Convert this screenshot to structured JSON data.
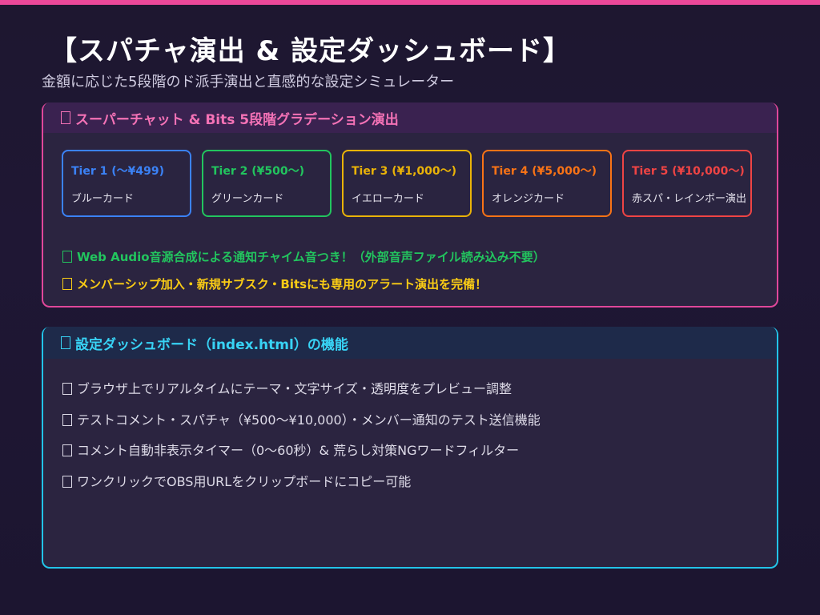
{
  "header": {
    "title": "【スパチャ演出 & 設定ダッシュボード】",
    "subtitle": "金額に応じた5段階のド派手演出と直感的な設定シミュレーター"
  },
  "superchat_section": {
    "heading": "スーパーチャット & Bits 5段階グラデーション演出",
    "tiers": [
      {
        "name": "Tier 1 (〜¥499)",
        "desc": "ブルーカード",
        "color": "#3b82f6"
      },
      {
        "name": "Tier 2 (¥500〜)",
        "desc": "グリーンカード",
        "color": "#22c55e"
      },
      {
        "name": "Tier 3 (¥1,000〜)",
        "desc": "イエローカード",
        "color": "#eab308"
      },
      {
        "name": "Tier 4 (¥5,000〜)",
        "desc": "オレンジカード",
        "color": "#f97316"
      },
      {
        "name": "Tier 5 (¥10,000〜)",
        "desc": "赤スパ・レインボー演出",
        "color": "#ef4444"
      }
    ],
    "features": [
      {
        "text": "Web Audio音源合成による通知チャイム音つき！（外部音声ファイル読み込み不要）",
        "color": "#22c55e"
      },
      {
        "text": "メンバーシップ加入・新規サブスク・Bitsにも専用のアラート演出を完備！",
        "color": "#facc15"
      }
    ]
  },
  "dashboard_section": {
    "heading": "設定ダッシュボード（index.html）の機能",
    "items": [
      "ブラウザ上でリアルタイムにテーマ・文字サイズ・透明度をプレビュー調整",
      "テストコメント・スパチャ（¥500〜¥10,000）・メンバー通知のテスト送信機能",
      "コメント自動非表示タイマー（0〜60秒）& 荒らし対策NGワードフィルター",
      "ワンクリックでOBS用URLをクリップボードにコピー可能"
    ]
  },
  "colors": {
    "accent_pink": "#ec4899",
    "accent_cyan": "#22c4e8"
  }
}
